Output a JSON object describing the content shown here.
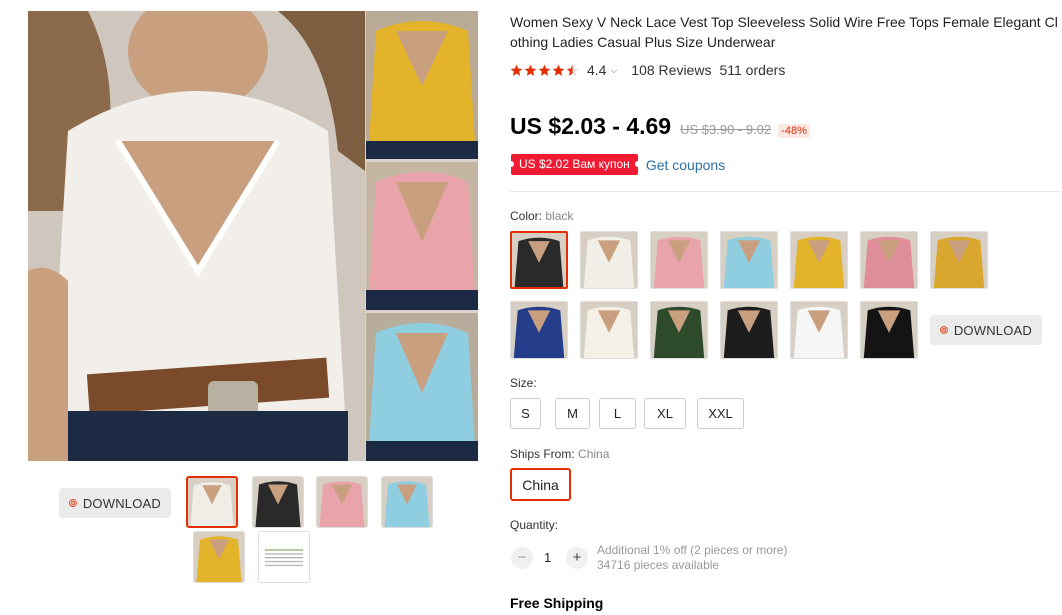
{
  "product": {
    "title": "Women Sexy V Neck Lace Vest Top Sleeveless Solid Wire Free Tops Female Elegant Clothing Ladies Casual Plus Size Underwear",
    "rating": 4.4,
    "rating_label": "4.4",
    "reviews": "108 Reviews",
    "orders": "511 orders",
    "stars_filled": 4.5
  },
  "price": {
    "current": "US $2.03 - 4.69",
    "original": "US $3.90 - 9.02",
    "discount": "-48%"
  },
  "coupon": {
    "badge": "US $2.02 Вам купон",
    "link": "Get coupons"
  },
  "color": {
    "label": "Color:",
    "selected": "black",
    "swatches": [
      {
        "name": "black",
        "fill": "#2a2a2a"
      },
      {
        "name": "white",
        "fill": "#f2efe9"
      },
      {
        "name": "pink",
        "fill": "#e9a3aa"
      },
      {
        "name": "sky-blue",
        "fill": "#8fcde0"
      },
      {
        "name": "yellow",
        "fill": "#e3b32a"
      },
      {
        "name": "rose",
        "fill": "#df8d98"
      },
      {
        "name": "mustard",
        "fill": "#d9a62e"
      },
      {
        "name": "navy",
        "fill": "#243e8c"
      },
      {
        "name": "cream",
        "fill": "#f4f0e6"
      },
      {
        "name": "green",
        "fill": "#2d4a2a"
      },
      {
        "name": "black-strappy",
        "fill": "#1d1d1d"
      },
      {
        "name": "white-strappy",
        "fill": "#f6f6f6"
      },
      {
        "name": "black-cami",
        "fill": "#141414"
      }
    ]
  },
  "size": {
    "label": "Size:",
    "options": [
      "S",
      "M",
      "L",
      "XL",
      "XXL"
    ]
  },
  "ships_from": {
    "label": "Ships From:",
    "selected": "China",
    "option": "China"
  },
  "quantity": {
    "label": "Quantity:",
    "value": "1",
    "minus": "−",
    "plus": "+",
    "promo": "Additional 1% off (2 pieces or more)",
    "available": "34716 pieces available"
  },
  "shipping": {
    "label": "Free Shipping"
  },
  "download_label": "DOWNLOAD",
  "gallery": {
    "thumbs": [
      {
        "name": "white",
        "fill": "#f0ece6"
      },
      {
        "name": "black",
        "fill": "#2a2a2a"
      },
      {
        "name": "pink",
        "fill": "#e9a3aa"
      },
      {
        "name": "blue",
        "fill": "#8fcde0"
      },
      {
        "name": "yellow",
        "fill": "#e3b32a"
      },
      {
        "name": "size-chart",
        "fill": "#ffffff"
      }
    ]
  },
  "colors": {
    "accent": "#e62e04",
    "coupon_red": "#f01b33",
    "link_blue": "#2e6ea8",
    "star_red": "#e62e04"
  }
}
